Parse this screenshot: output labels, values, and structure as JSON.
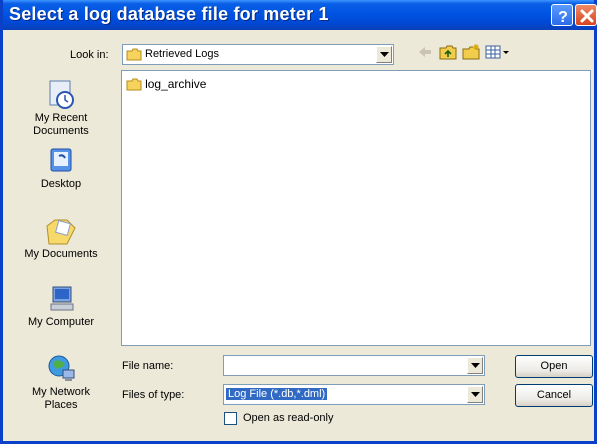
{
  "dialog": {
    "title": "Select a log database file for meter 1"
  },
  "toolbar": {
    "look_in_label": "Look in:",
    "look_in_value": "Retrieved Logs"
  },
  "places": [
    {
      "label": "My Recent\nDocuments",
      "icon": "recent-documents-icon"
    },
    {
      "label": "Desktop",
      "icon": "desktop-icon"
    },
    {
      "label": "My Documents",
      "icon": "my-documents-icon"
    },
    {
      "label": "My Computer",
      "icon": "my-computer-icon"
    },
    {
      "label": "My Network\nPlaces",
      "icon": "network-places-icon"
    }
  ],
  "files": [
    {
      "name": "log_archive",
      "icon": "folder-icon"
    }
  ],
  "form": {
    "file_name_label": "File name:",
    "file_name_value": "",
    "files_of_type_label": "Files of type:",
    "files_of_type_value": "Log File (*.db,*.dml)",
    "readonly_label": "Open as read-only",
    "readonly_checked": false
  },
  "buttons": {
    "open": "Open",
    "cancel": "Cancel"
  },
  "colors": {
    "titlebar": "#0054e3",
    "selection": "#316ac5",
    "close_button": "#d6451f"
  }
}
